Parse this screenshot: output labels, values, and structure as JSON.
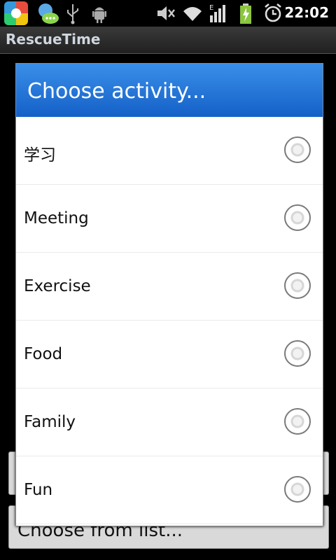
{
  "status_bar": {
    "time": "22:02"
  },
  "app": {
    "title": "RescueTime"
  },
  "background": {
    "choose_button_label": "Choose from list..."
  },
  "dialog": {
    "title": "Choose activity...",
    "options": [
      {
        "label": "学习"
      },
      {
        "label": "Meeting"
      },
      {
        "label": "Exercise"
      },
      {
        "label": "Food"
      },
      {
        "label": "Family"
      },
      {
        "label": "Fun"
      }
    ]
  }
}
